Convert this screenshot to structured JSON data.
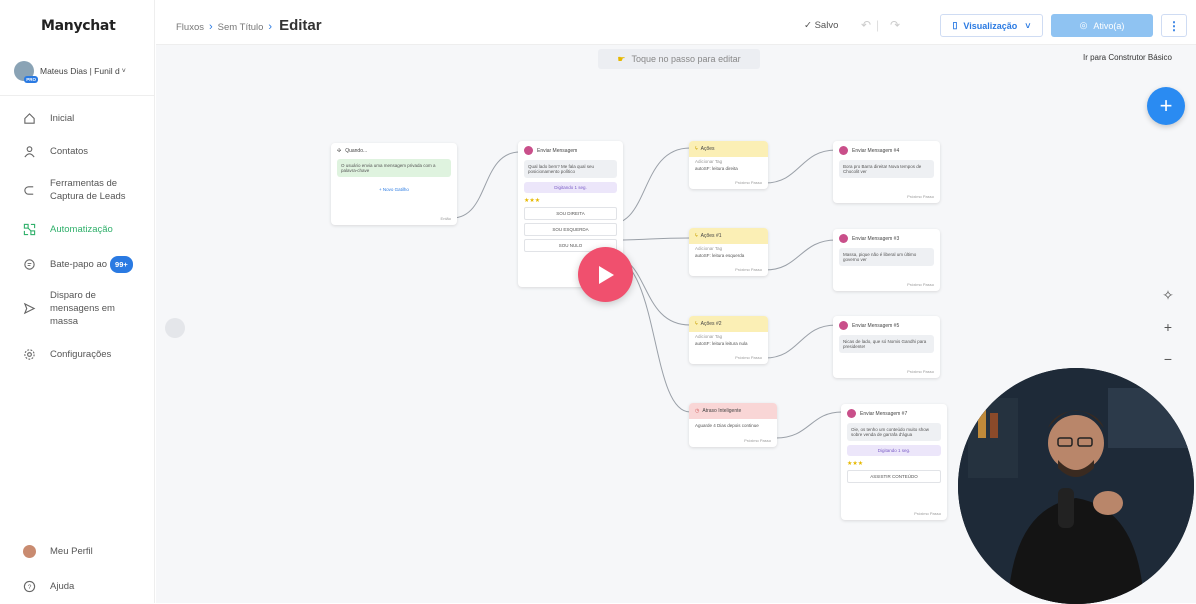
{
  "app": {
    "logo": "Manychat"
  },
  "account": {
    "name": "Mateus Dias | Funil d",
    "pro_badge": "PRO"
  },
  "nav": {
    "inicial": "Inicial",
    "contatos": "Contatos",
    "ferramentas_1": "Ferramentas de",
    "ferramentas_2": "Captura de Leads",
    "automatizacao": "Automatização",
    "batepapo": "Bate-papo ao",
    "batepapo_badge": "99+",
    "disparo_1": "Disparo de",
    "disparo_2": "mensagens em",
    "disparo_3": "massa",
    "config": "Configurações",
    "perfil": "Meu Perfil",
    "ajuda": "Ajuda"
  },
  "breadcrumb": {
    "item1": "Fluxos",
    "item2": "Sem Título",
    "current": "Editar"
  },
  "toolbar": {
    "saved": "✓ Salvo",
    "visualizacao": "Visualização",
    "ativo": "Ativo(a)",
    "more": "⋮",
    "tooltip": "Ir para Construtor Básico"
  },
  "canvas": {
    "hint": "Toque no passo para editar",
    "trigger": {
      "title": "Quando...",
      "msg": "O usuário envia uma mensagem privada com a palavra-chave",
      "link": "+ Novo Gatilho",
      "foot": "Então"
    },
    "send1": {
      "title": "Enviar Mensagem",
      "msg": "Qual lado bem? Me fala qual seu posicionamento político",
      "delay": "Digitando 1 seg.",
      "opt1": "SOU DIREITA",
      "opt2": "SOU ESQUERDA",
      "opt3": "SOU NULO"
    },
    "acao": {
      "title": "Ações",
      "tag_label": "Adicionar Tag",
      "tag": "autoSF: leitura direita",
      "foot": "Próximo Passo"
    },
    "acao1": {
      "title": "Ações #1",
      "tag_label": "Adicionar Tag",
      "tag": "autoSF: leitura esquerda",
      "foot": "Próximo Passo"
    },
    "acao2": {
      "title": "Ações #2",
      "tag_label": "Adicionar Tag",
      "tag": "autoSF: leitura leitura nula",
      "foot": "Próximo Passo"
    },
    "smart": {
      "title": "Atraso Inteligente",
      "msg": "Aguarde 4 Dias depois continue",
      "foot": "Próximo Passo"
    },
    "m4": {
      "title": "Enviar Mensagem #4",
      "msg": "Bora pro Barra direita! Nova tempos de Chocolit ver",
      "foot": "Próximo Passo"
    },
    "m3": {
      "title": "Enviar Mensagem #3",
      "msg": "Massa, pique não é liberal um último governo ver",
      "foot": "Próximo Passo"
    },
    "m5": {
      "title": "Enviar Mensagem #5",
      "msg": "Nicas de lado, que só Nomis Gandhi para presidente!",
      "foot": "Próximo Passo"
    },
    "m7": {
      "title": "Enviar Mensagem #7",
      "msg": "Oie, os tenho um conteúdo muito show sobre venda de garrafa d'água",
      "delay": "Digitando 1 seg.",
      "opt": "ASSISTIR CONTEÚDO",
      "foot": "Próximo Passo"
    }
  },
  "colors": {
    "accent": "#2a7ae2",
    "active_nav": "#30b06b",
    "play": "#f0506e"
  }
}
